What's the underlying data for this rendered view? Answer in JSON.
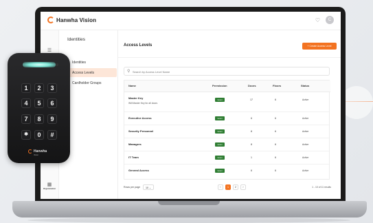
{
  "app": {
    "brand": "Hanwha Vision",
    "avatar_initial": "C"
  },
  "rail": {
    "items": [
      {
        "label": "Operations"
      },
      {
        "label": "Organization"
      }
    ]
  },
  "subnav": {
    "title": "Identities",
    "items": [
      {
        "label": "Identities",
        "active": false
      },
      {
        "label": "Access Levels",
        "active": true
      },
      {
        "label": "Cardholder Groups",
        "active": false
      }
    ]
  },
  "main": {
    "title": "Access Levels",
    "create_button": "+ Create Access Level",
    "search_placeholder": "Search by Access Level Name"
  },
  "table": {
    "headers": {
      "name": "Name",
      "permission": "Permission",
      "doors": "Doors",
      "floors": "Floors",
      "status": "Status"
    },
    "rows": [
      {
        "name": "Master Key",
        "description": "Will Master Key for all doors",
        "permission": "Grant",
        "doors": "17",
        "floors": "6",
        "status": "Active"
      },
      {
        "name": "Executive Access",
        "description": "",
        "permission": "Grant",
        "doors": "6",
        "floors": "6",
        "status": "Active"
      },
      {
        "name": "Security Personnel",
        "description": "",
        "permission": "Grant",
        "doors": "8",
        "floors": "6",
        "status": "Active"
      },
      {
        "name": "Managers",
        "description": "",
        "permission": "Grant",
        "doors": "8",
        "floors": "6",
        "status": "Active"
      },
      {
        "name": "IT Team",
        "description": "",
        "permission": "Grant",
        "doors": "1",
        "floors": "6",
        "status": "Active"
      },
      {
        "name": "General Access",
        "description": "",
        "permission": "Grant",
        "doors": "6",
        "floors": "6",
        "status": "Active"
      }
    ]
  },
  "pagination": {
    "rows_per_page_label": "Rows per page",
    "rows_per_page_value": "10",
    "pages": [
      "1",
      "2"
    ],
    "current_page": "1",
    "prev": "‹",
    "next": "›",
    "results": "1 - 10 of 11 results"
  },
  "device": {
    "keys": [
      "1",
      "2",
      "3",
      "4",
      "5",
      "6",
      "7",
      "8",
      "9",
      "✱",
      "0",
      "#"
    ],
    "brand": "Hanwha",
    "brand_sub": "Vision"
  },
  "colors": {
    "accent": "#f37321",
    "grant": "#2e7d32",
    "active_nav_bg": "#fde6d8"
  },
  "icons": {
    "bell": "bell-icon",
    "search": "search-icon",
    "menu": "menu-icon"
  }
}
